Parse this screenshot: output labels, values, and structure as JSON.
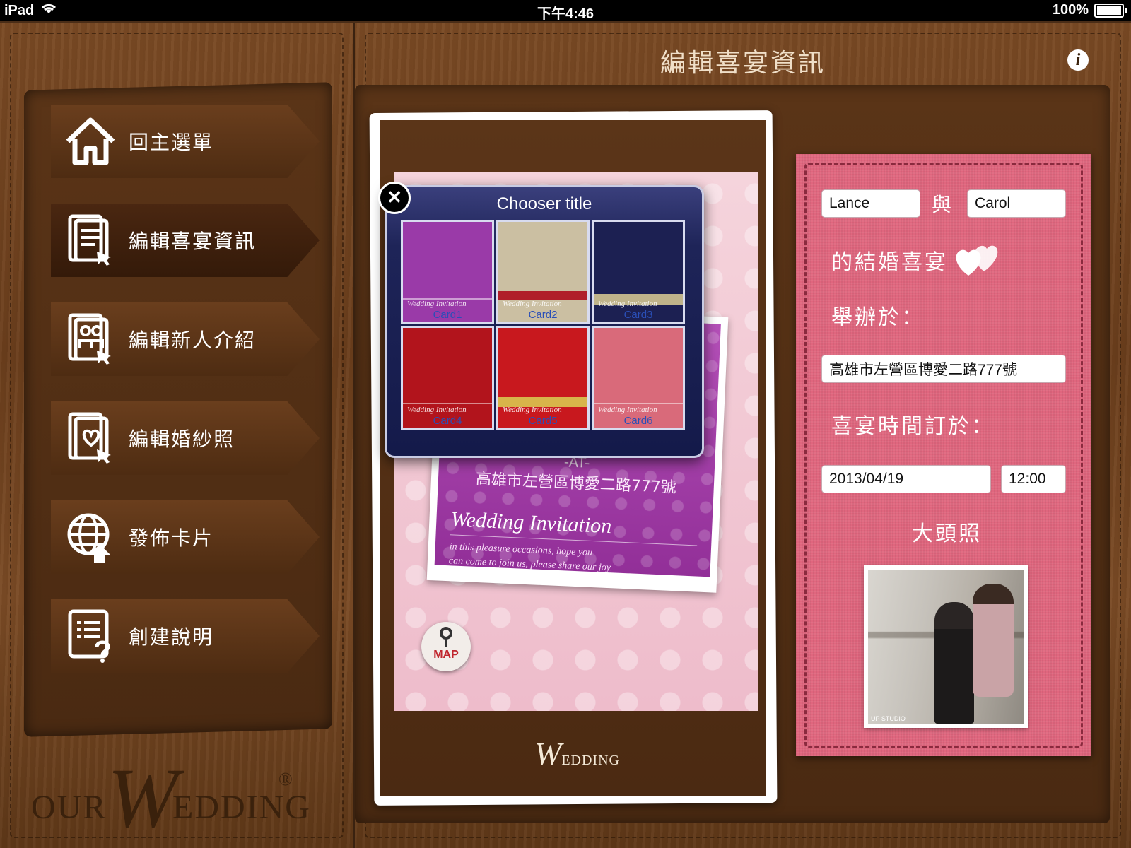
{
  "status_bar": {
    "device": "iPad",
    "time": "下午4:46",
    "battery": "100%"
  },
  "header": {
    "title": "編輯喜宴資訊",
    "info_icon": "i"
  },
  "sidebar": {
    "items": [
      {
        "label": "回主選單",
        "icon": "home-icon"
      },
      {
        "label": "編輯喜宴資訊",
        "icon": "edit-document-icon",
        "active": true
      },
      {
        "label": "編輯新人介紹",
        "icon": "edit-couple-icon"
      },
      {
        "label": "編輯婚紗照",
        "icon": "edit-photo-icon"
      },
      {
        "label": "發佈卡片",
        "icon": "globe-upload-icon"
      },
      {
        "label": "創建說明",
        "icon": "help-document-icon"
      }
    ],
    "brand": {
      "our": "OUR",
      "w": "W",
      "edding": "EDDING",
      "reg": "®"
    }
  },
  "preview": {
    "at": "-AT-",
    "address": "高雄市左營區博愛二路777號",
    "wedding_script": "Wedding Invitation",
    "sub_line1": "in this pleasure occasions, hope you",
    "sub_line2": "can come to join us, please share our joy.",
    "map_label": "MAP",
    "logo_w": "W",
    "logo_edding": "EDDING"
  },
  "chooser": {
    "title": "Chooser title",
    "close": "✕",
    "cards": [
      {
        "label": "Card1",
        "color": "#9a3aa8"
      },
      {
        "label": "Card2",
        "color": "#cbbfa2"
      },
      {
        "label": "Card3",
        "color": "#1c2052"
      },
      {
        "label": "Card4",
        "color": "#b2141c"
      },
      {
        "label": "Card5",
        "color": "#c8181e"
      },
      {
        "label": "Card6",
        "color": "#d96a7a"
      }
    ],
    "script": "Wedding Invitation"
  },
  "form": {
    "groom": "Lance",
    "and": "與",
    "bride": "Carol",
    "wedding_of": "的結婚喜宴",
    "held_at_label": "舉辦於：",
    "address": "高雄市左營區博愛二路777號",
    "time_label": "喜宴時間訂於：",
    "date": "2013/04/19",
    "time": "12:00",
    "avatar_label": "大頭照",
    "studio": "UP STUDIO"
  },
  "colors": {
    "wood": "#6b3e1c",
    "form_pink": "#e0667e",
    "chooser_bg": "#141a4a"
  }
}
